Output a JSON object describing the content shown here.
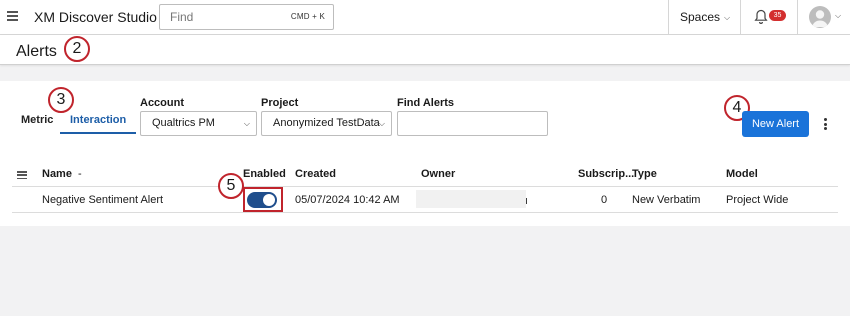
{
  "topbar": {
    "app_title": "XM Discover Studio",
    "search_placeholder": "Find",
    "search_shortcut": "CMD + K",
    "spaces_label": "Spaces",
    "notification_count": "35"
  },
  "page": {
    "title": "Alerts"
  },
  "steps": {
    "s2": "2",
    "s3": "3",
    "s4": "4",
    "s5": "5"
  },
  "tabs": [
    {
      "label": "Metric",
      "active": false
    },
    {
      "label": "Interaction",
      "active": true
    }
  ],
  "filters": {
    "account_label": "Account",
    "account_value": "Qualtrics PM",
    "project_label": "Project",
    "project_value": "Anonymized TestData",
    "find_label": "Find Alerts",
    "find_value": ""
  },
  "actions": {
    "new_alert_label": "New Alert"
  },
  "table": {
    "columns": {
      "name": "Name",
      "name_sort": "-",
      "enabled": "Enabled",
      "created": "Created",
      "owner": "Owner",
      "subscriptions": "Subscrip...",
      "type": "Type",
      "model": "Model"
    },
    "rows": [
      {
        "name": "Negative Sentiment Alert",
        "enabled": true,
        "created": "05/07/2024 10:42 AM",
        "owner_tail": "ı",
        "subscriptions": "0",
        "type": "New Verbatim",
        "model": "Project Wide"
      }
    ]
  },
  "colors": {
    "accent": "#1a73d9",
    "tab_active": "#1d5ea8",
    "toggle_on": "#1f4e8c",
    "step_marker": "#c0242c",
    "badge": "#d32f2f"
  }
}
